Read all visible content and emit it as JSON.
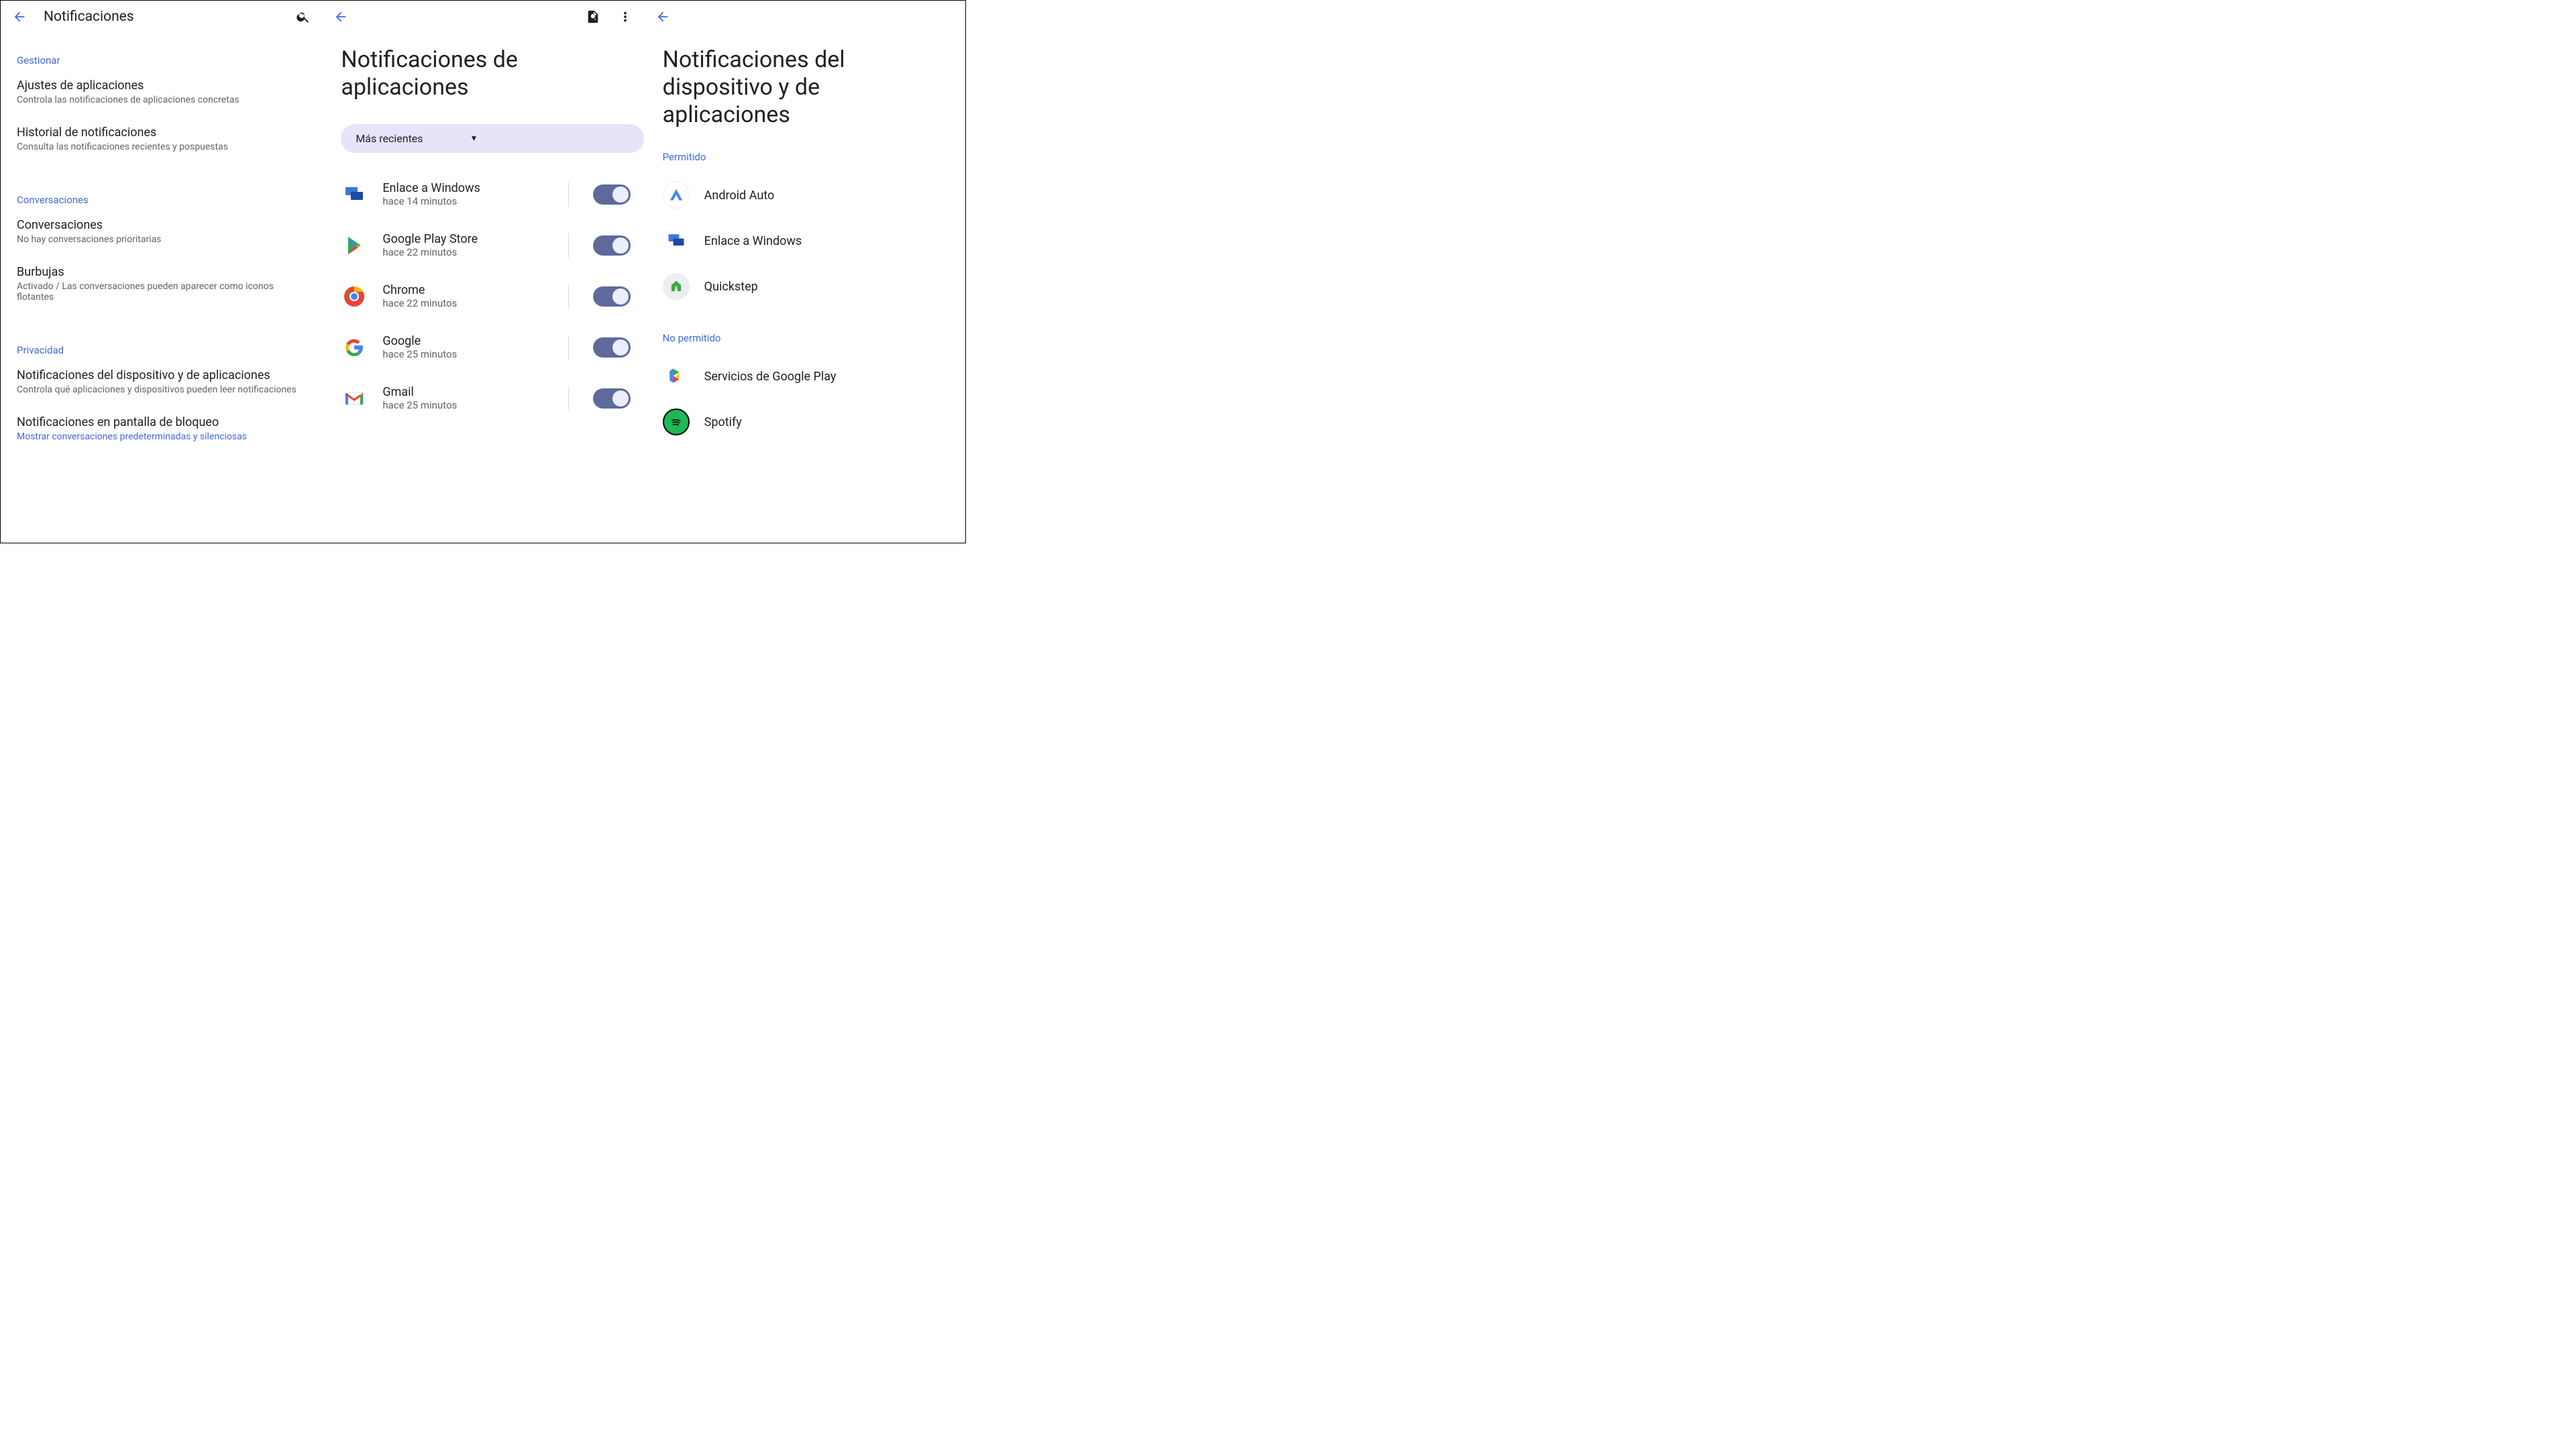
{
  "pane1": {
    "title": "Notificaciones",
    "sections": {
      "manage": {
        "header": "Gestionar",
        "appSettings": {
          "title": "Ajustes de aplicaciones",
          "sub": "Controla las notificaciones de aplicaciones concretas"
        },
        "history": {
          "title": "Historial de notificaciones",
          "sub": "Consulta las notificaciones recientes y pospuestas"
        }
      },
      "conversations": {
        "header": "Conversaciones",
        "convs": {
          "title": "Conversaciones",
          "sub": "No hay conversaciones prioritarias"
        },
        "bubbles": {
          "title": "Burbujas",
          "sub": "Activado / Las conversaciones pueden aparecer como iconos flotantes"
        }
      },
      "privacy": {
        "header": "Privacidad",
        "deviceApp": {
          "title": "Notificaciones del dispositivo y de aplicaciones",
          "sub": "Controla qué aplicaciones y dispositivos pueden leer notificaciones"
        },
        "lockscreen": {
          "title": "Notificaciones en pantalla de bloqueo",
          "sub": "Mostrar conversaciones predeterminadas y silenciosas"
        }
      }
    }
  },
  "pane2": {
    "title": "Notificaciones de aplicaciones",
    "filter": "Más recientes",
    "apps": [
      {
        "name": "Enlace a Windows",
        "time": "hace 14 minutos"
      },
      {
        "name": "Google Play Store",
        "time": "hace 22 minutos"
      },
      {
        "name": "Chrome",
        "time": "hace 22 minutos"
      },
      {
        "name": "Google",
        "time": "hace 25 minutos"
      },
      {
        "name": "Gmail",
        "time": "hace 25 minutos"
      }
    ]
  },
  "pane3": {
    "title": "Notificaciones del dispositivo y de aplicaciones",
    "allowed": {
      "header": "Permitido",
      "items": [
        "Android Auto",
        "Enlace a Windows",
        "Quickstep"
      ]
    },
    "notAllowed": {
      "header": "No permitido",
      "items": [
        "Servicios de Google Play",
        "Spotify"
      ]
    }
  }
}
